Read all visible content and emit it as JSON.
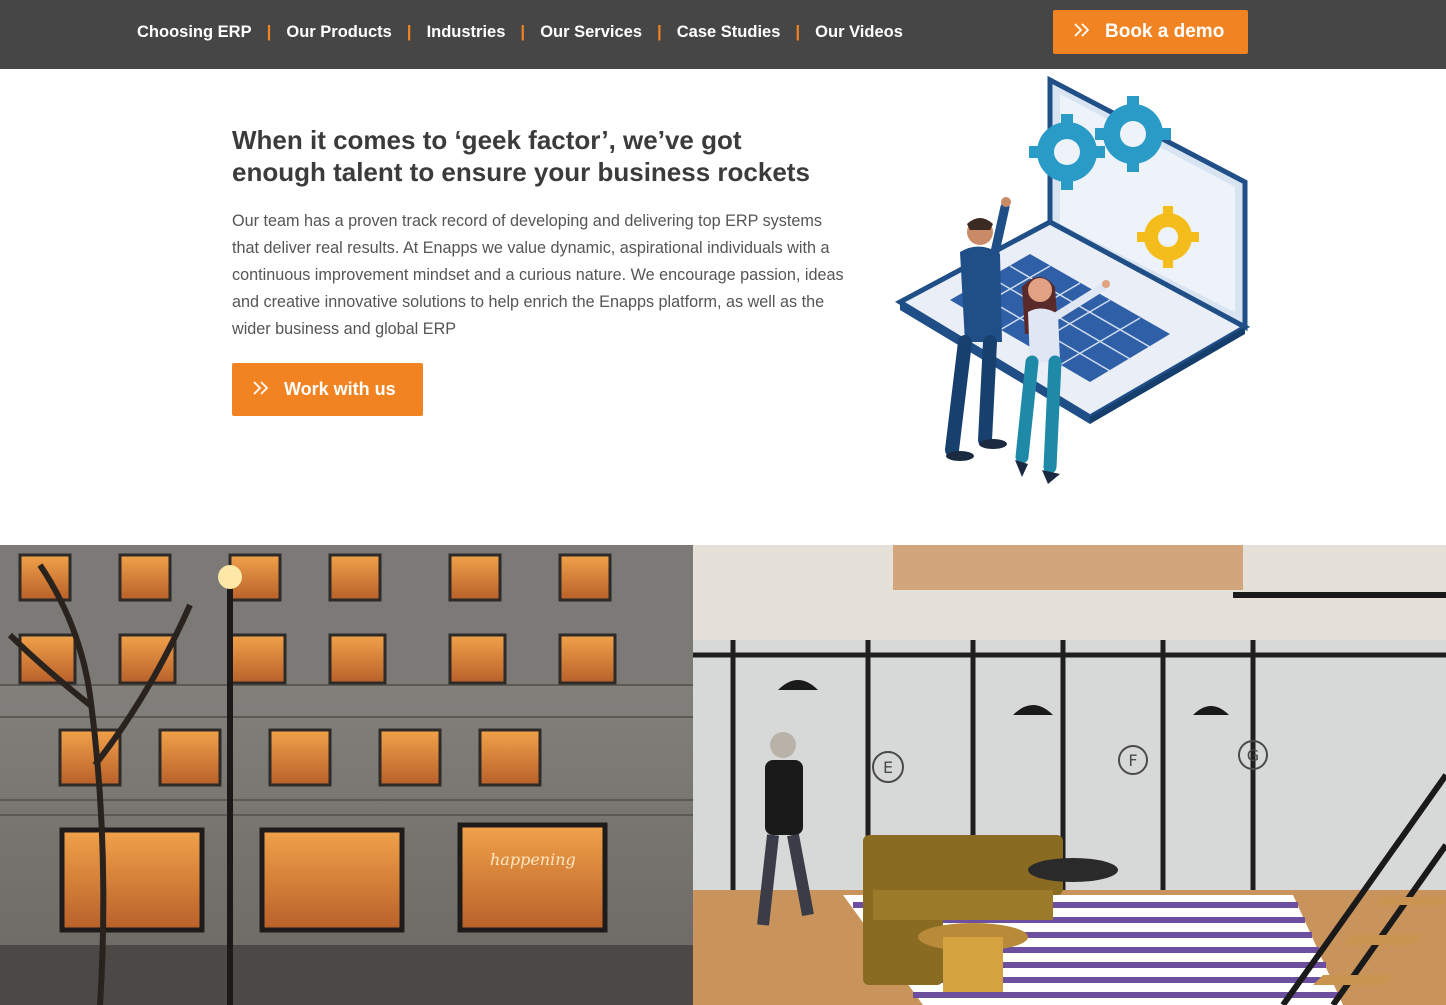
{
  "nav": {
    "items": [
      {
        "label": "Choosing ERP"
      },
      {
        "label": "Our Products"
      },
      {
        "label": "Industries"
      },
      {
        "label": "Our Services"
      },
      {
        "label": "Case Studies"
      },
      {
        "label": "Our Videos"
      }
    ],
    "separator": "|",
    "cta_label": "Book a demo"
  },
  "hero": {
    "heading_line1": "When it comes to ‘geek factor’, we’ve got",
    "heading_line2": "enough talent to ensure your business rockets",
    "body": "Our team has a proven track record of developing and delivering top ERP systems that deliver real results. At Enapps we value dynamic, aspirational individuals with a continuous improvement mindset and a curious nature. We encourage passion, ideas and creative innovative solutions to help enrich the Enapps platform, as well as the wider business and global ERP",
    "cta_label": "Work with us"
  },
  "photos": {
    "left_signs": [
      "happening"
    ],
    "right_room_letters": [
      "E",
      "F",
      "G"
    ]
  },
  "colors": {
    "nav_bg": "#464646",
    "accent": "#f28322",
    "heading": "#3b3b3b",
    "body_text": "#555555"
  },
  "icons": {
    "cta_icon": "double-chevron-right-icon"
  }
}
